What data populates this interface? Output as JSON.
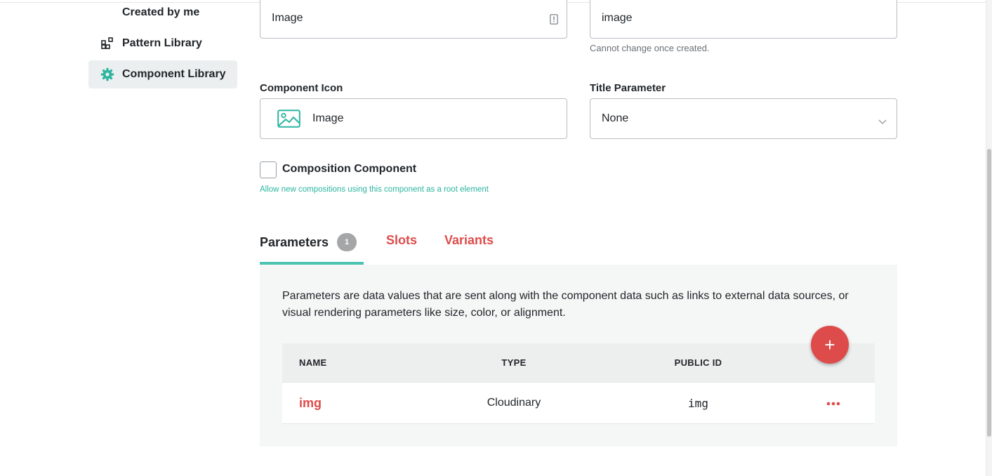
{
  "sidebar": {
    "items": [
      {
        "label": "Created by me"
      },
      {
        "label": "Pattern Library",
        "icon": "pattern-grid-icon"
      },
      {
        "label": "Component Library",
        "icon": "gear-icon",
        "active": true
      }
    ]
  },
  "form": {
    "name_value": "Image",
    "public_id_value": "image",
    "public_id_hint": "Cannot change once created.",
    "component_icon_label": "Component Icon",
    "component_icon_value": "Image",
    "title_param_label": "Title Parameter",
    "title_param_value": "None",
    "composition_label": "Composition Component",
    "composition_hint": "Allow new compositions using this component as a root element"
  },
  "tabs": {
    "parameters": {
      "label": "Parameters",
      "count": "1"
    },
    "slots": {
      "label": "Slots"
    },
    "variants": {
      "label": "Variants"
    }
  },
  "panel": {
    "description": "Parameters are data values that are sent along with the component data such as links to external data sources, or visual rendering parameters like size, color, or alignment.",
    "add_button": "+",
    "table": {
      "headers": {
        "name": "NAME",
        "type": "TYPE",
        "public_id": "PUBLIC ID"
      },
      "rows": [
        {
          "name": "img",
          "type": "Cloudinary",
          "public_id": "img",
          "actions": "•••"
        }
      ]
    }
  },
  "colors": {
    "accent": "#4dc3b1",
    "danger": "#dd4c4a"
  }
}
